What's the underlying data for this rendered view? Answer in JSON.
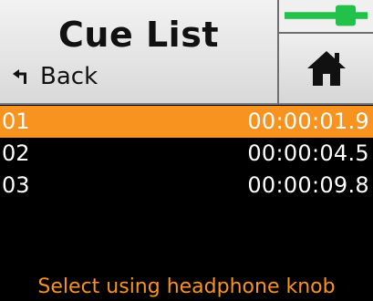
{
  "header": {
    "title": "Cue List",
    "back_label": "Back"
  },
  "meter": {
    "level": 0.85,
    "color": "#22c24a"
  },
  "home": {
    "icon": "home-icon"
  },
  "cues": [
    {
      "number": "01",
      "time": "00:00:01.9",
      "selected": true
    },
    {
      "number": "02",
      "time": "00:00:04.5",
      "selected": false
    },
    {
      "number": "03",
      "time": "00:00:09.8",
      "selected": false
    }
  ],
  "hint": "Select using headphone knob",
  "colors": {
    "accent": "#f7931e",
    "background": "#000000",
    "header": "#e6e6e6"
  }
}
